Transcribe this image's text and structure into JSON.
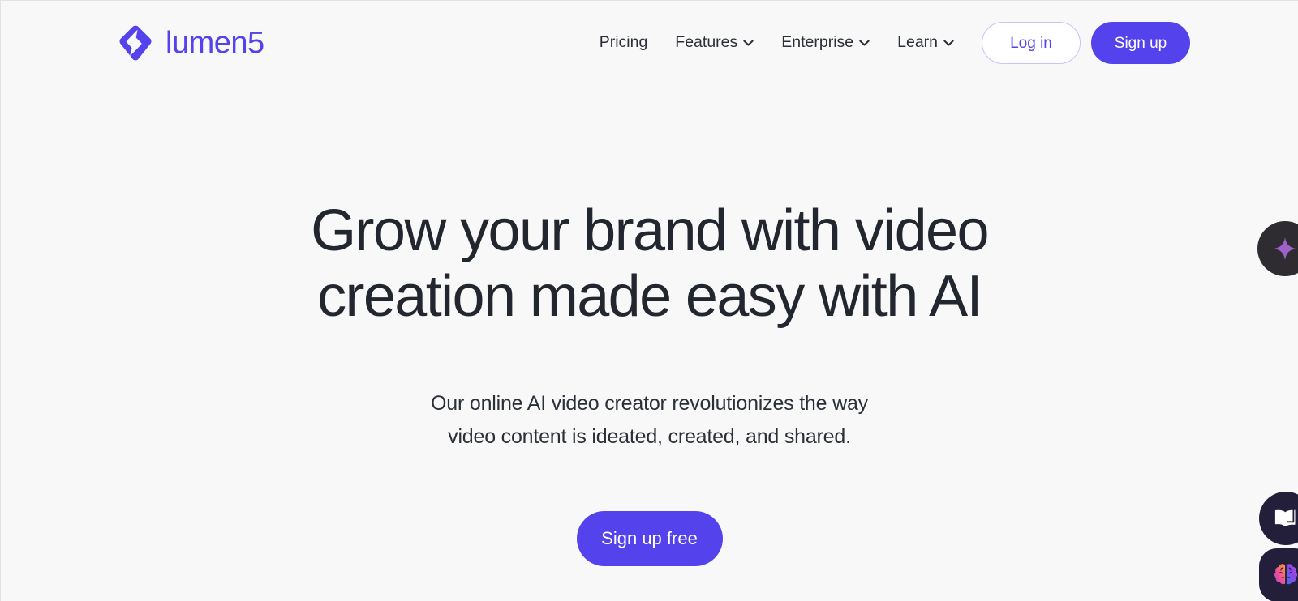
{
  "theme": {
    "brand_purple": "#5442ed",
    "page_background": "#f8f8f8",
    "heading_color": "#22262e",
    "widget_dark": "#231f3a"
  },
  "header": {
    "brand": {
      "logo_icon": "lumen5-diamond-bolt-logo",
      "name": "lumen5"
    },
    "nav": [
      {
        "label": "Pricing",
        "has_dropdown": false
      },
      {
        "label": "Features",
        "has_dropdown": true
      },
      {
        "label": "Enterprise",
        "has_dropdown": true
      },
      {
        "label": "Learn",
        "has_dropdown": true
      }
    ],
    "login_label": "Log in",
    "signup_label": "Sign up"
  },
  "hero": {
    "title_line_1": "Grow your brand with video",
    "title_line_2": "creation made easy with AI",
    "subtitle_line_1": "Our online AI video creator revolutionizes the way",
    "subtitle_line_2": "video content is ideated, created, and shared.",
    "cta_label": "Sign up free"
  },
  "floating_widgets": [
    {
      "icon": "sparkle-icon"
    },
    {
      "icon": "open-book-icon"
    },
    {
      "icon": "brain-icon"
    }
  ]
}
